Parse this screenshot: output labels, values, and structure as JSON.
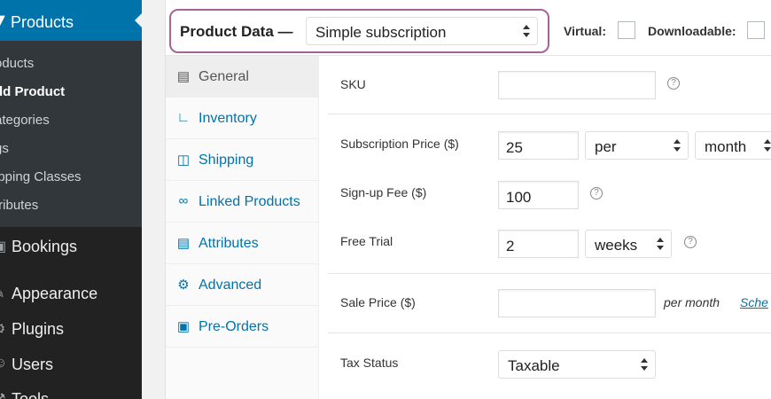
{
  "sidebar": {
    "active_menu": {
      "icon": "tag-icon",
      "label": "Products"
    },
    "submenu": [
      {
        "label": "oducts"
      },
      {
        "label": "dd Product"
      },
      {
        "label": "ategories"
      },
      {
        "label": "gs"
      },
      {
        "label": "ipping Classes"
      },
      {
        "label": "tributes"
      }
    ],
    "menu": [
      {
        "icon": "calendar-icon",
        "label": "Bookings"
      },
      {
        "icon": "brush-icon",
        "label": "Appearance"
      },
      {
        "icon": "plug-icon",
        "label": "Plugins"
      },
      {
        "icon": "users-icon",
        "label": "Users"
      },
      {
        "icon": "wrench-icon",
        "label": "Tools"
      }
    ]
  },
  "header": {
    "product_data_label": "Product Data —",
    "product_type_value": "Simple subscription",
    "virtual_label": "Virtual:",
    "downloadable_label": "Downloadable:"
  },
  "tabs": [
    {
      "icon": "list-icon",
      "label": "General"
    },
    {
      "icon": "chart-icon",
      "label": "Inventory"
    },
    {
      "icon": "truck-icon",
      "label": "Shipping"
    },
    {
      "icon": "link-icon",
      "label": "Linked Products"
    },
    {
      "icon": "table-icon",
      "label": "Attributes"
    },
    {
      "icon": "gear-icon",
      "label": "Advanced"
    },
    {
      "icon": "calendar-icon",
      "label": "Pre-Orders"
    }
  ],
  "general": {
    "sku": {
      "label": "SKU",
      "value": ""
    },
    "subscription_price": {
      "label": "Subscription Price ($)",
      "value": "25",
      "per": "per",
      "period": "month"
    },
    "signup_fee": {
      "label": "Sign-up Fee ($)",
      "value": "100"
    },
    "free_trial": {
      "label": "Free Trial",
      "value": "2",
      "period": "weeks"
    },
    "sale_price": {
      "label": "Sale Price ($)",
      "value": "",
      "suffix": "per month",
      "schedule_link": "Sche"
    },
    "tax_status": {
      "label": "Tax Status",
      "value": "Taxable"
    }
  },
  "help_glyph": "?",
  "colors": {
    "accent": "#0073aa",
    "highlight_border": "#a46497",
    "sidebar_bg": "#222222"
  }
}
